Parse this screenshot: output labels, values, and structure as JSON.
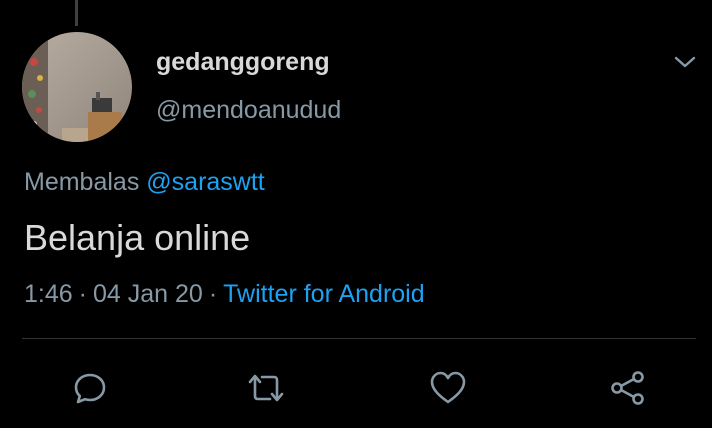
{
  "tweet": {
    "display_name": "gedanggoreng",
    "handle": "@mendoanudud",
    "reply_prefix": "Membalas",
    "reply_to": "@saraswtt",
    "text": "Belanja online",
    "time": "1:46",
    "date": "04 Jan 20",
    "separator": "·",
    "source": "Twitter for Android"
  },
  "actions": {
    "icons": [
      "reply-icon",
      "retweet-icon",
      "like-icon",
      "share-icon"
    ]
  },
  "colors": {
    "background": "#000000",
    "text_primary": "#d9d9d9",
    "text_secondary": "#8899a6",
    "accent": "#1da1f2",
    "divider": "#2f3336"
  }
}
